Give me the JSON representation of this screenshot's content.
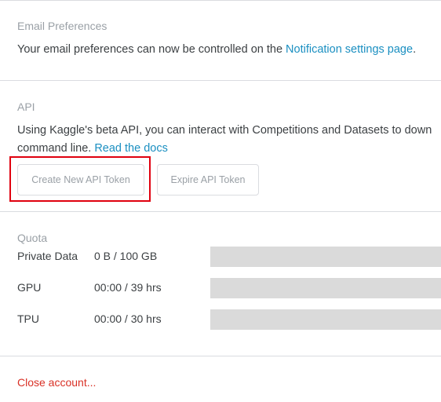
{
  "email": {
    "title": "Email Preferences",
    "text_before": "Your email preferences can now be controlled on the ",
    "link": "Notification settings page",
    "text_after": "."
  },
  "api": {
    "title": "API",
    "line1": "Using Kaggle's beta API, you can interact with Competitions and Datasets to down",
    "line2": "command line. ",
    "docs_link": "Read the docs",
    "create_button": "Create New API Token",
    "expire_button": "Expire API Token"
  },
  "quota": {
    "title": "Quota",
    "rows": [
      {
        "label": "Private Data",
        "value": "0 B / 100 GB",
        "used_fraction": 0
      },
      {
        "label": "GPU",
        "value": "00:00 / 39 hrs",
        "used_fraction": 0
      },
      {
        "label": "TPU",
        "value": "00:00 / 30 hrs",
        "used_fraction": 0
      }
    ]
  },
  "account": {
    "close_link": "Close account..."
  }
}
